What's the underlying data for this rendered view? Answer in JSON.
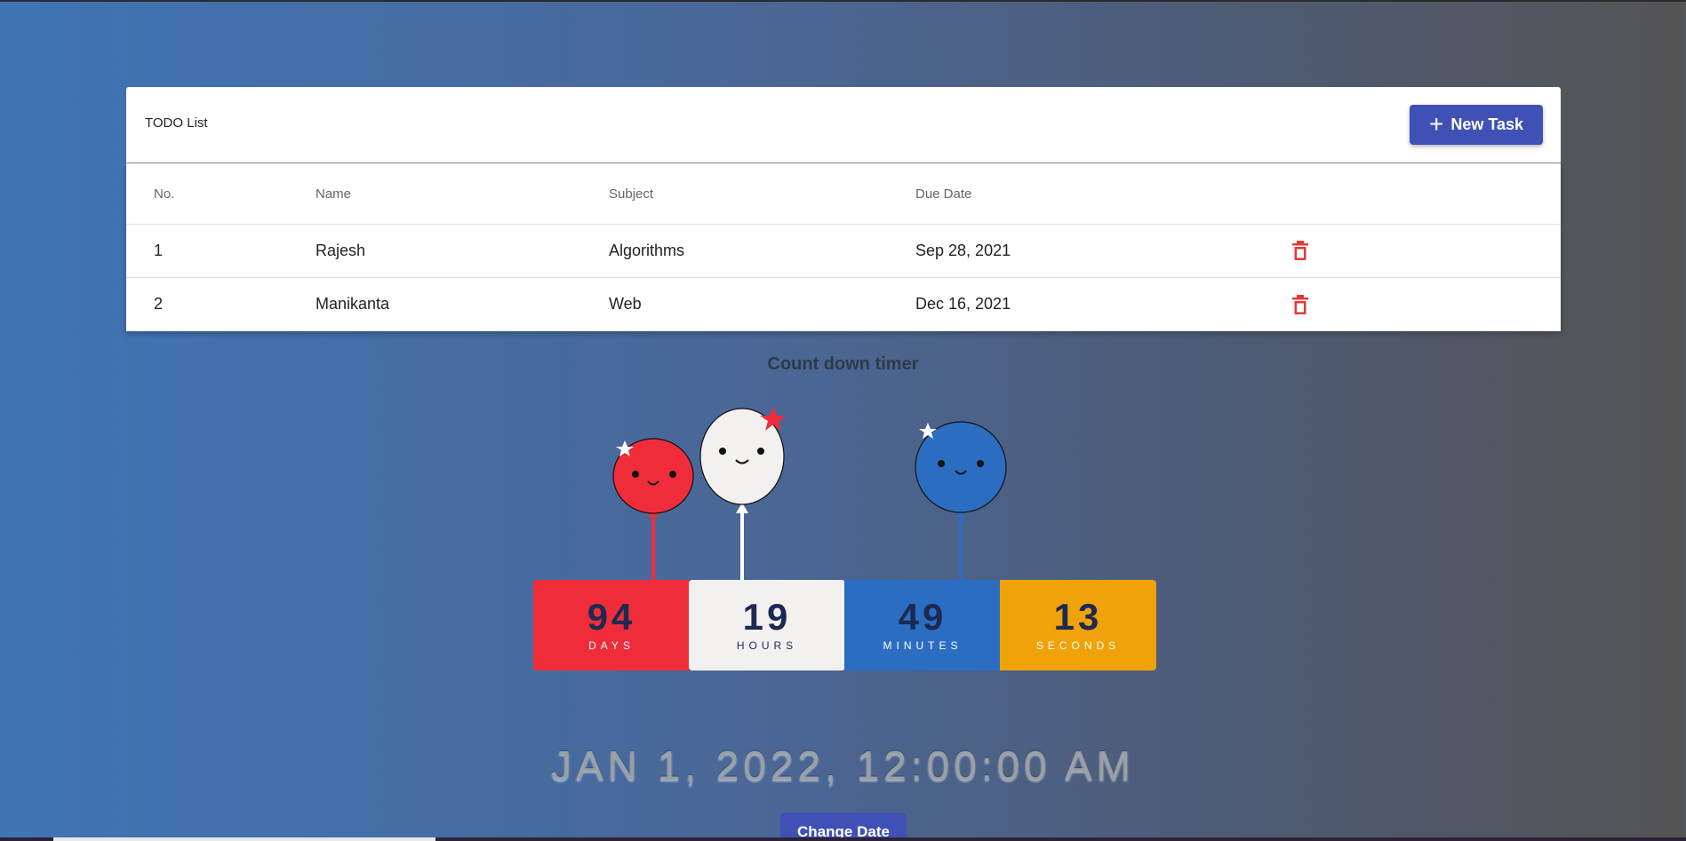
{
  "todo": {
    "title": "TODO List",
    "new_task_label": "New Task",
    "columns": [
      "No.",
      "Name",
      "Subject",
      "Due Date"
    ],
    "rows": [
      {
        "no": "1",
        "name": "Rajesh",
        "subject": "Algorithms",
        "due": "Sep 28, 2021"
      },
      {
        "no": "2",
        "name": "Manikanta",
        "subject": "Web",
        "due": "Dec 16, 2021"
      }
    ]
  },
  "countdown": {
    "title": "Count down timer",
    "units": [
      {
        "value": "94",
        "label": "DAYS"
      },
      {
        "value": "19",
        "label": "HOURS"
      },
      {
        "value": "49",
        "label": "MINUTES"
      },
      {
        "value": "13",
        "label": "SECONDS"
      }
    ],
    "target": "JAN 1, 2022, 12:00:00 AM",
    "change_date_label": "Change Date"
  },
  "icons": {
    "add": "plus-icon",
    "delete": "trash-icon"
  },
  "colors": {
    "accent": "#3f51b5",
    "delete": "#e53935",
    "days": "#ef2d3a",
    "hours": "#f2f1ef",
    "minutes": "#2b6ec1",
    "seconds": "#f0a20a"
  }
}
